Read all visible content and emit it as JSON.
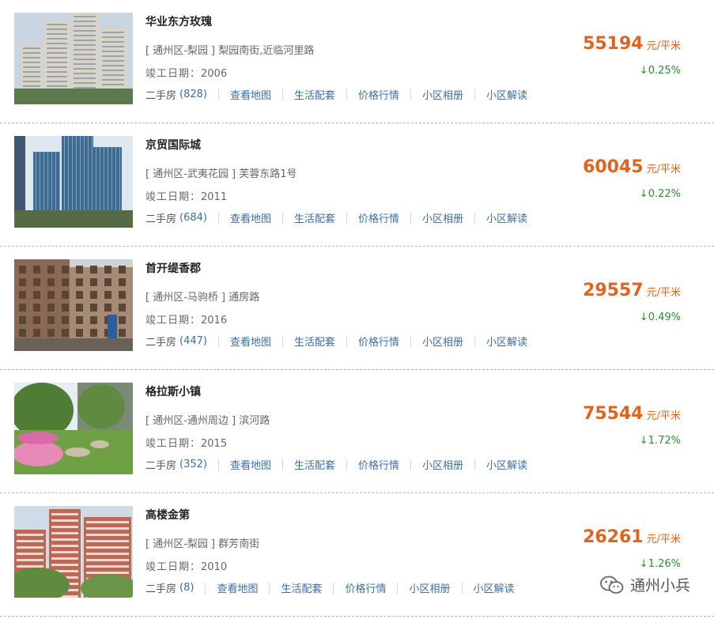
{
  "listings": [
    {
      "name": "华业东方玫瑰",
      "address": "[ 通州区-梨园 ] 梨园南街,近临河里路",
      "completion_label": "竣工日期：",
      "completion_year": "2006",
      "ershou_label": "二手房",
      "ershou_count": "(828)",
      "links": [
        "查看地图",
        "生活配套",
        "价格行情",
        "小区相册",
        "小区解读"
      ],
      "price": "55194",
      "unit": "元/平米",
      "change": "↓0.25%",
      "photo_kind": "tower-light"
    },
    {
      "name": "京贸国际城",
      "address": "[ 通州区-武夷花园 ] 芙蓉东路1号",
      "completion_label": "竣工日期：",
      "completion_year": "2011",
      "ershou_label": "二手房",
      "ershou_count": "(684)",
      "links": [
        "查看地图",
        "生活配套",
        "价格行情",
        "小区相册",
        "小区解读"
      ],
      "price": "60045",
      "unit": "元/平米",
      "change": "↓0.22%",
      "photo_kind": "tower-blue"
    },
    {
      "name": "首开缇香郡",
      "address": "[ 通州区-马驹桥 ] 通房路",
      "completion_label": "竣工日期：",
      "completion_year": "2016",
      "ershou_label": "二手房",
      "ershou_count": "(447)",
      "links": [
        "查看地图",
        "生活配套",
        "价格行情",
        "小区相册",
        "小区解读"
      ],
      "price": "29557",
      "unit": "元/平米",
      "change": "↓0.49%",
      "photo_kind": "lowrise-brown"
    },
    {
      "name": "格拉斯小镇",
      "address": "[ 通州区-通州周边 ] 滨河路",
      "completion_label": "竣工日期：",
      "completion_year": "2015",
      "ershou_label": "二手房",
      "ershou_count": "(352)",
      "links": [
        "查看地图",
        "生活配套",
        "价格行情",
        "小区相册",
        "小区解读"
      ],
      "price": "75544",
      "unit": "元/平米",
      "change": "↓1.72%",
      "photo_kind": "garden"
    },
    {
      "name": "高楼金第",
      "address": "[ 通州区-梨园 ] 群芳南街",
      "completion_label": "竣工日期：",
      "completion_year": "2010",
      "ershou_label": "二手房",
      "ershou_count": "(8)",
      "links": [
        "查看地图",
        "生活配套",
        "价格行情",
        "小区相册",
        "小区解读"
      ],
      "price": "26261",
      "unit": "元/平米",
      "change": "↓1.26%",
      "photo_kind": "tower-red"
    }
  ],
  "watermark": {
    "text": "通州小兵",
    "icon": "wechat-icon"
  },
  "colors": {
    "price": "#e0641e",
    "change_down": "#2e8b2e",
    "link": "#3a6ea8"
  }
}
